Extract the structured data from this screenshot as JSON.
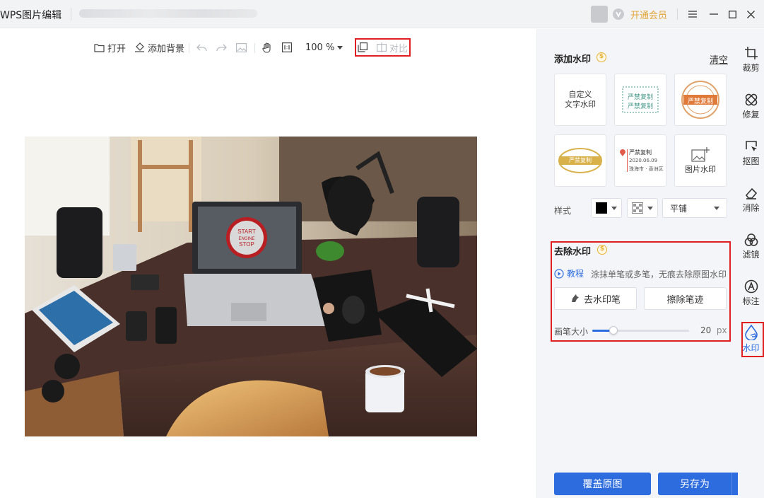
{
  "app": {
    "title": "WPS图片编辑",
    "vip_label": "开通会员"
  },
  "toolbar": {
    "open": "打开",
    "add_bg": "添加背景",
    "zoom": "100 %",
    "compare": "对比"
  },
  "canvas": {
    "laptop_badge": [
      "START",
      "ENGINE",
      "STOP"
    ]
  },
  "add_watermark": {
    "title": "添加水印",
    "clear": "清空",
    "cards": [
      {
        "label": "自定义\n文字水印"
      },
      {
        "label": "严禁复制 严禁复制"
      },
      {
        "label": "严禁复制"
      },
      {
        "label": "严禁复制"
      },
      {
        "label": "严禁复制 2020.06.09 珠海市·香洲区"
      },
      {
        "label": "图片水印"
      }
    ],
    "stamp_text": "严禁复制",
    "stamp_date": "2020.06.09",
    "stamp_place": "珠海市 · 香洲区",
    "style_label": "样式",
    "tile_option": "平铺"
  },
  "remove_watermark": {
    "title": "去除水印",
    "tutorial": "教程",
    "description": "涂抹单笔或多笔，无痕去除原图水印",
    "remove_button": "去水印笔",
    "erase_button": "擦除笔迹",
    "brush_label": "画笔大小",
    "brush_value": "20",
    "brush_unit": "px",
    "brush_fraction": 0.22
  },
  "footer": {
    "overwrite": "覆盖原图",
    "save_as": "另存为"
  },
  "side_tools": [
    {
      "label": "裁剪",
      "icon": "crop-icon"
    },
    {
      "label": "修复",
      "icon": "repair-icon"
    },
    {
      "label": "抠图",
      "icon": "cutout-icon"
    },
    {
      "label": "消除",
      "icon": "eraser-icon"
    },
    {
      "label": "滤镜",
      "icon": "filter-icon"
    },
    {
      "label": "标注",
      "icon": "annotate-icon"
    },
    {
      "label": "水印",
      "icon": "watermark-icon"
    }
  ],
  "colors": {
    "accent": "#2d6cdf",
    "highlight": "#e02020",
    "vip": "#e3a53a"
  }
}
